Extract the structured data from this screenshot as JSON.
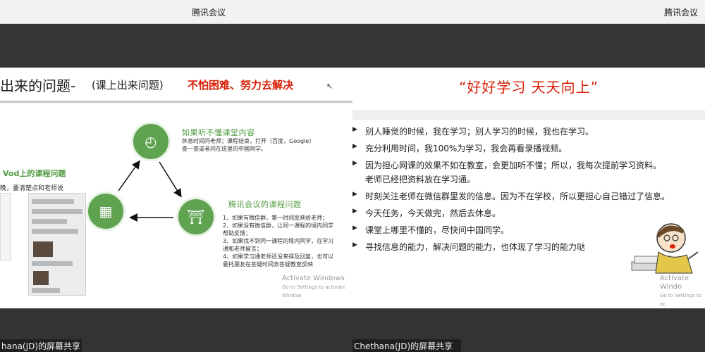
{
  "left_window": {
    "app_title": "腾讯会议",
    "share_label": "hana(JD)的屏幕共享",
    "slide": {
      "title": "出来的问题-",
      "subtitle": "(课上出来问题)",
      "red_text": "不怕困难、努力去解决",
      "section_top": {
        "title": "如果听不懂课堂内容",
        "line1": "休息时间问老师；课程结束，打开（百度，Google）",
        "line2": "查一查或者问在班里的中国同学。"
      },
      "section_vod": {
        "title": "Vod上的课程问题",
        "note": "晚，要清楚点和老师说"
      },
      "section_tencent": {
        "title": "腾讯会议的课程问题",
        "lines": [
          "1、如果有微信群，第一时间反映给老师；",
          "2、如果没有微信群，让同一课程的境内同学",
          "帮助反馈；",
          "3、如果找不到同一课程的境内同学，在学习",
          "通和老师留言；",
          "4、如果学习通老师还没来得及回复，也可以",
          "委托朋友在答疑时间去答疑教室反映"
        ]
      },
      "icons": [
        "chart-growth-icon",
        "building-icon",
        "bank-icon"
      ],
      "watermark_title": "Activate Windows",
      "watermark_sub": "Go to Settings to activate Window"
    }
  },
  "right_window": {
    "app_title": "腾讯会议",
    "share_label": "Chethana(JD)的屏幕共享",
    "slide": {
      "title": "“好好学习  天天向上”",
      "bullets": [
        "别人睡觉的时候，我在学习；别人学习的时候，我也在学习。",
        "充分利用时间，我100%为学习，我会再看录播视频。",
        "因为担心网课的效果不如在教室，会更加听不懂；所以，我每次提前学习资料。",
        "老师已经把资料放在学习通。",
        "时刻关注老师在微信群里发的信息。因为不在学校，所以更担心自己错过了信息。",
        "今天任务，今天做完，然后去休息。",
        "课堂上哪里不懂的，尽快问中国同学。",
        "寻找信息的能力，解决问题的能力，也体现了学习的能力哒"
      ],
      "bullet_has_marker": [
        true,
        true,
        true,
        false,
        true,
        true,
        true,
        true
      ],
      "watermark_title": "Activate Windo",
      "watermark_sub": "Go to Settings to ac"
    }
  },
  "colors": {
    "accent_red": "#d81e06",
    "accent_green": "#5fa351",
    "titlebar": "#f2f2f2",
    "background": "#333333"
  }
}
